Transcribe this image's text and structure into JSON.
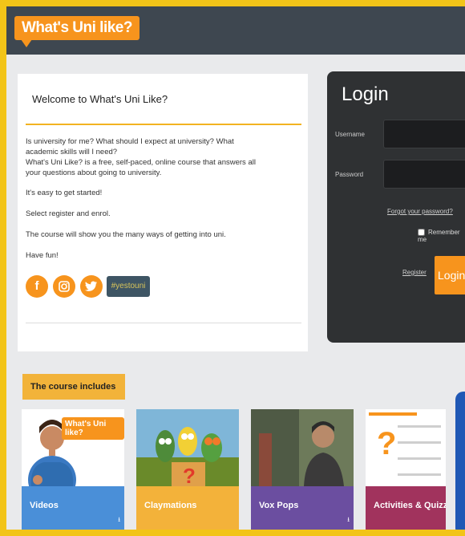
{
  "header": {
    "logo_text": "What's Uni like?"
  },
  "welcome": {
    "title": "Welcome to What's Uni Like?",
    "paragraphs": [
      "Is university for me? What should I expect at university? What academic skills will I need?",
      "What's Uni Like? is a free, self-paced, online course that answers all your questions about going to university.",
      "It's easy to get started!",
      "Select register and enrol.",
      "The course will show you the many ways of getting into uni.",
      "Have fun!"
    ],
    "hashtag": "#yestouni",
    "social_icons": [
      "facebook-icon",
      "instagram-icon",
      "twitter-icon"
    ]
  },
  "login": {
    "title": "Login",
    "username_label": "Username",
    "username_value": "",
    "password_label": "Password",
    "password_value": "",
    "forgot_link": "Forgot your password?",
    "remember_label": "Remember me",
    "register_link": "Register",
    "login_button": "Login"
  },
  "course": {
    "heading": "The course includes",
    "tiles": [
      {
        "label": "Videos",
        "color": "#4a8fd8",
        "badge": "What's Uni like?"
      },
      {
        "label": "Claymations",
        "color": "#f3b23a"
      },
      {
        "label": "Vox Pops",
        "color": "#6b4ea0"
      },
      {
        "label": "Activities & Quizzes",
        "color": "#a1335d"
      }
    ]
  },
  "colors": {
    "accent": "#f7941d",
    "header": "#3e4750",
    "border": "#f2c418"
  }
}
